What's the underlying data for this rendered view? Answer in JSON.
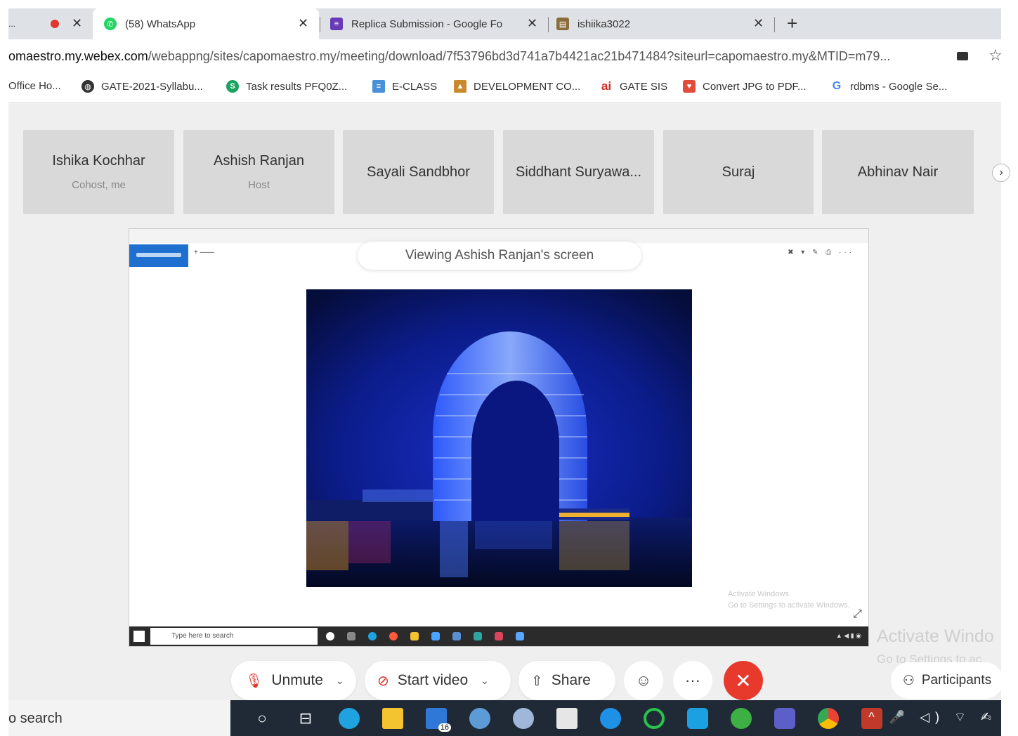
{
  "browser": {
    "tabs": [
      {
        "label": "..."
      },
      {
        "label": "(58) WhatsApp"
      },
      {
        "label": "Replica Submission - Google Fo"
      },
      {
        "label": "ishiika3022"
      }
    ],
    "new_tab": "+",
    "url_host": "omaestro.my.webex.com",
    "url_path": "/webappng/sites/capomaestro.my/meeting/download/7f53796bd3d741a7b4421ac21b471484?siteurl=capomaestro.my&MTID=m79...",
    "bookmarks": [
      {
        "label": "Office Ho..."
      },
      {
        "label": "GATE-2021-Syllabu..."
      },
      {
        "label": "Task results PFQ0Z..."
      },
      {
        "label": "E-CLASS"
      },
      {
        "label": "DEVELOPMENT CO..."
      },
      {
        "label": "GATE SIS"
      },
      {
        "label": "Convert JPG to PDF..."
      },
      {
        "label": "rdbms - Google Se..."
      }
    ]
  },
  "participants": [
    {
      "name": "Ishika Kochhar",
      "role": "Cohost, me"
    },
    {
      "name": "Ashish Ranjan",
      "role": "Host"
    },
    {
      "name": "Sayali Sandbhor",
      "role": ""
    },
    {
      "name": "Siddhant Suryawa...",
      "role": ""
    },
    {
      "name": "Suraj",
      "role": ""
    },
    {
      "name": "Abhinav Nair",
      "role": ""
    }
  ],
  "shared_screen": {
    "banner": "Viewing Ashish Ranjan's screen",
    "inner_search": "Type here to search",
    "inner_watermark_1": "Activate Windows",
    "inner_watermark_2": "Go to Settings to activate Windows."
  },
  "watermark": {
    "line1": "Activate Windo",
    "line2": "Go to Settings to ac"
  },
  "controls": {
    "unmute": "Unmute",
    "start_video": "Start video",
    "share": "Share",
    "more": "···",
    "end": "✕",
    "participants": "Participants"
  },
  "taskbar": {
    "search": "o search",
    "mail_badge": "16"
  },
  "colors": {
    "end_call": "#e8392d",
    "night_sky": "#0a1a7a",
    "taskbar": "#1f2a36"
  }
}
